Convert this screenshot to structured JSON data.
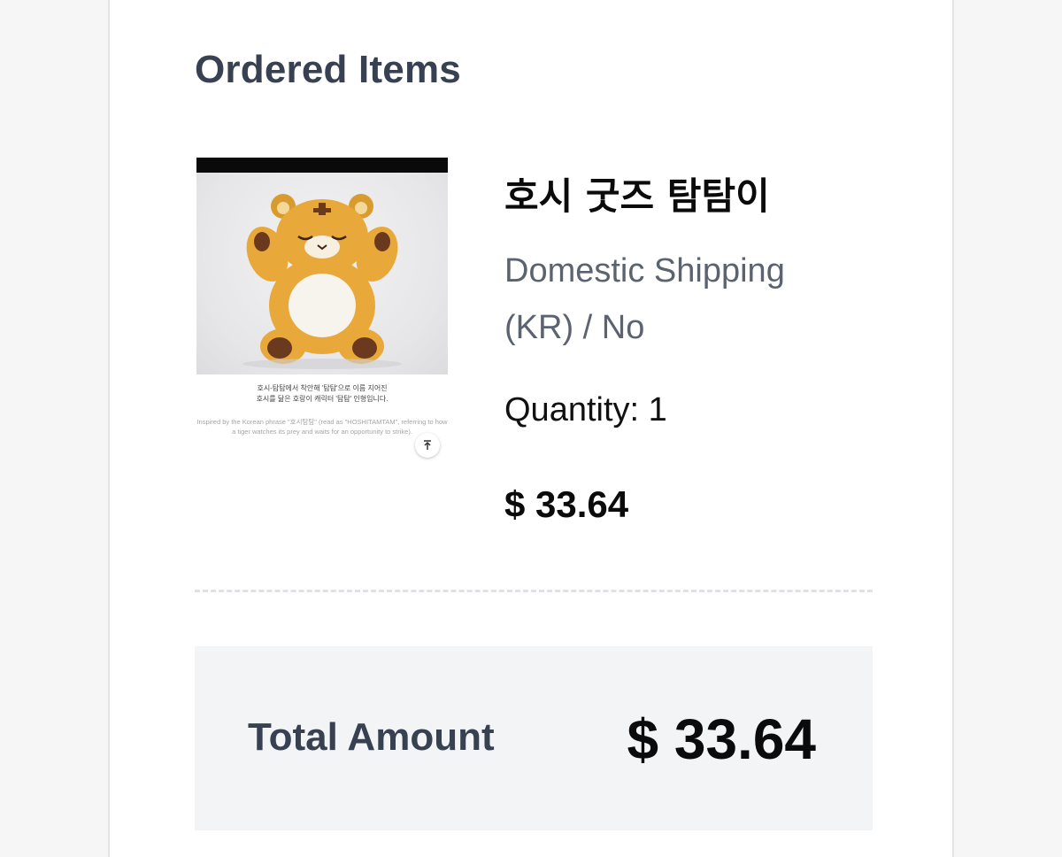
{
  "order": {
    "section_title": "Ordered Items",
    "item": {
      "name": "호시 굿즈 탐탐이",
      "option": "Domestic Shipping (KR) / No",
      "quantity_text": "Quantity: 1",
      "price": "$ 33.64",
      "image": {
        "caption_ko_line1": "호시-탐탐에서 착안해 '탐탐'으로 이름 지어진",
        "caption_ko_line2": "호시를 닮은 호랑이 캐릭터 '탐탐' 인형입니다.",
        "caption_en": "Inspired by the Korean phrase \"호시탐탐\" (read as \"HOSHITAMTAM\", referring to how a tiger watches its prey and waits for an opportunity to strike)."
      }
    },
    "total_label": "Total Amount",
    "total_value": "$ 33.64"
  },
  "colors": {
    "page_bg": "#f6f6f7",
    "heading": "#374151",
    "muted_text": "#5c6370",
    "total_bg": "#f3f4f6",
    "plush_orange": "#e8a93a"
  },
  "icons": {
    "scroll_top": "arrow-up-to-line-icon"
  }
}
